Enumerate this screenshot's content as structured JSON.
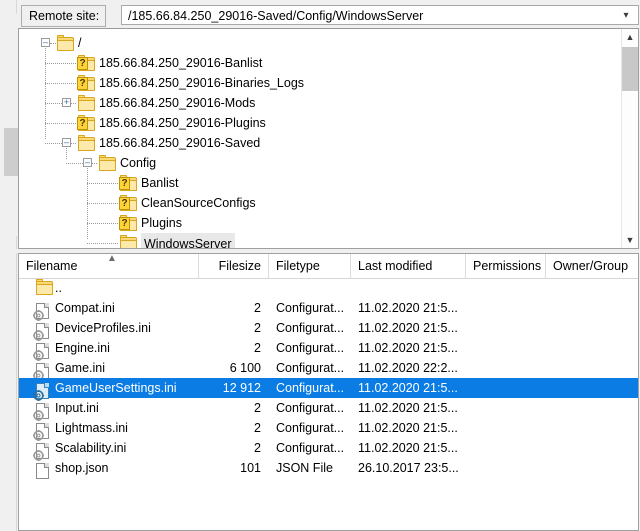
{
  "window": {
    "app": "FileZilla remote pane"
  },
  "remote_site": {
    "label": "Remote site:",
    "path": "/185.66.84.250_29016-Saved/Config/WindowsServer",
    "dropdown_icon": "chevron-down-icon"
  },
  "tree": {
    "scrollbar": {
      "up_icon": "chevron-up-icon",
      "down_icon": "chevron-down-icon"
    },
    "nodes": [
      {
        "label": "/",
        "depth": 0,
        "expander": "minus",
        "icon": "folder-icon",
        "selected": false
      },
      {
        "label": "185.66.84.250_29016-Banlist",
        "depth": 1,
        "expander": "none",
        "icon": "folder-unknown-icon",
        "selected": false
      },
      {
        "label": "185.66.84.250_29016-Binaries_Logs",
        "depth": 1,
        "expander": "none",
        "icon": "folder-unknown-icon",
        "selected": false
      },
      {
        "label": "185.66.84.250_29016-Mods",
        "depth": 1,
        "expander": "plus",
        "icon": "folder-icon",
        "selected": false
      },
      {
        "label": "185.66.84.250_29016-Plugins",
        "depth": 1,
        "expander": "none",
        "icon": "folder-unknown-icon",
        "selected": false
      },
      {
        "label": "185.66.84.250_29016-Saved",
        "depth": 1,
        "expander": "minus",
        "icon": "folder-icon",
        "selected": false
      },
      {
        "label": "Config",
        "depth": 2,
        "expander": "minus",
        "icon": "folder-icon",
        "selected": false
      },
      {
        "label": "Banlist",
        "depth": 3,
        "expander": "none",
        "icon": "folder-unknown-icon",
        "selected": false
      },
      {
        "label": "CleanSourceConfigs",
        "depth": 3,
        "expander": "none",
        "icon": "folder-unknown-icon",
        "selected": false
      },
      {
        "label": "Plugins",
        "depth": 3,
        "expander": "none",
        "icon": "folder-unknown-icon",
        "selected": false
      },
      {
        "label": "WindowsServer",
        "depth": 3,
        "expander": "none",
        "icon": "folder-icon",
        "selected": true
      }
    ]
  },
  "file_list": {
    "sort_indicator": "sort-ascending-icon",
    "columns": [
      {
        "key": "filename",
        "label": "Filename",
        "align": "left"
      },
      {
        "key": "filesize",
        "label": "Filesize",
        "align": "right"
      },
      {
        "key": "filetype",
        "label": "Filetype",
        "align": "left"
      },
      {
        "key": "modified",
        "label": "Last modified",
        "align": "left"
      },
      {
        "key": "permissions",
        "label": "Permissions",
        "align": "left"
      },
      {
        "key": "owner",
        "label": "Owner/Group",
        "align": "left"
      }
    ],
    "rows": [
      {
        "filename": "..",
        "filesize": "",
        "filetype": "",
        "modified": "",
        "permissions": "",
        "owner": "",
        "icon": "folder-icon",
        "selected": false
      },
      {
        "filename": "Compat.ini",
        "filesize": "2",
        "filetype": "Configurat...",
        "modified": "11.02.2020 21:5...",
        "permissions": "",
        "owner": "",
        "icon": "ini-file-icon",
        "selected": false
      },
      {
        "filename": "DeviceProfiles.ini",
        "filesize": "2",
        "filetype": "Configurat...",
        "modified": "11.02.2020 21:5...",
        "permissions": "",
        "owner": "",
        "icon": "ini-file-icon",
        "selected": false
      },
      {
        "filename": "Engine.ini",
        "filesize": "2",
        "filetype": "Configurat...",
        "modified": "11.02.2020 21:5...",
        "permissions": "",
        "owner": "",
        "icon": "ini-file-icon",
        "selected": false
      },
      {
        "filename": "Game.ini",
        "filesize": "6 100",
        "filetype": "Configurat...",
        "modified": "11.02.2020 22:2...",
        "permissions": "",
        "owner": "",
        "icon": "ini-file-icon",
        "selected": false
      },
      {
        "filename": "GameUserSettings.ini",
        "filesize": "12 912",
        "filetype": "Configurat...",
        "modified": "11.02.2020 21:5...",
        "permissions": "",
        "owner": "",
        "icon": "ini-file-icon",
        "selected": true
      },
      {
        "filename": "Input.ini",
        "filesize": "2",
        "filetype": "Configurat...",
        "modified": "11.02.2020 21:5...",
        "permissions": "",
        "owner": "",
        "icon": "ini-file-icon",
        "selected": false
      },
      {
        "filename": "Lightmass.ini",
        "filesize": "2",
        "filetype": "Configurat...",
        "modified": "11.02.2020 21:5...",
        "permissions": "",
        "owner": "",
        "icon": "ini-file-icon",
        "selected": false
      },
      {
        "filename": "Scalability.ini",
        "filesize": "2",
        "filetype": "Configurat...",
        "modified": "11.02.2020 21:5...",
        "permissions": "",
        "owner": "",
        "icon": "ini-file-icon",
        "selected": false
      },
      {
        "filename": "shop.json",
        "filesize": "101",
        "filetype": "JSON File",
        "modified": "26.10.2017 23:5...",
        "permissions": "",
        "owner": "",
        "icon": "json-file-icon",
        "selected": false
      }
    ]
  },
  "colors": {
    "selection": "#0a7ce4",
    "folder": "#fbd976",
    "folder_border": "#d9a61f",
    "panel_border": "#a0a0a0",
    "chrome": "#f0f0f0"
  }
}
